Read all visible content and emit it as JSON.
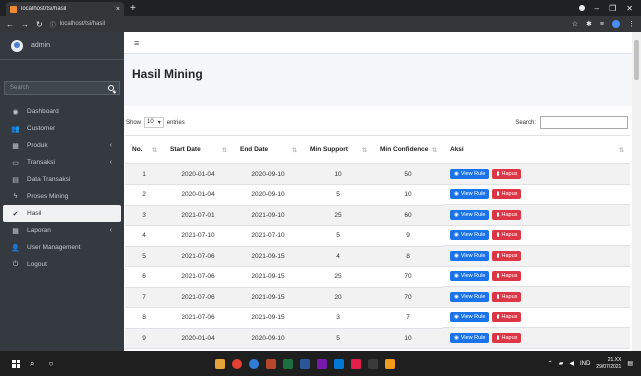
{
  "browser": {
    "tab_title": "localhost/tsi/hasil",
    "url": "localhost/tsi/hasil",
    "tab_close": "×",
    "new_tab": "+"
  },
  "sidebar": {
    "user": "admin",
    "search_placeholder": "Search",
    "items": [
      {
        "label": "Dashboard",
        "icon": "dashboard-icon",
        "glyph": "◉",
        "chevron": ""
      },
      {
        "label": "Customer",
        "icon": "users-icon",
        "glyph": "👥",
        "chevron": ""
      },
      {
        "label": "Produk",
        "icon": "table-icon",
        "glyph": "▦",
        "chevron": "‹"
      },
      {
        "label": "Transaksi",
        "icon": "tv-icon",
        "glyph": "▭",
        "chevron": "‹"
      },
      {
        "label": "Data Transaksi",
        "icon": "file-icon",
        "glyph": "▤",
        "chevron": ""
      },
      {
        "label": "Proses Mining",
        "icon": "bolt-icon",
        "glyph": "ϟ",
        "chevron": ""
      },
      {
        "label": "Hasil",
        "icon": "check-icon",
        "glyph": "✔",
        "chevron": ""
      },
      {
        "label": "Laporan",
        "icon": "report-icon",
        "glyph": "▦",
        "chevron": "‹"
      },
      {
        "label": "User Management",
        "icon": "user-icon",
        "glyph": "👤",
        "chevron": ""
      },
      {
        "label": "Logout",
        "icon": "power-icon",
        "glyph": "⏻",
        "chevron": ""
      }
    ]
  },
  "topbar": {
    "menu_glyph": "≡"
  },
  "page": {
    "title": "Hasil Mining"
  },
  "table_controls": {
    "show_label": "Show",
    "length_value": "10",
    "entries_label": "entries",
    "search_label": "Search:"
  },
  "table": {
    "columns": [
      "No.",
      "Start Date",
      "End Date",
      "Min Support",
      "Min Confidence",
      "Aksi"
    ],
    "rows": [
      [
        "1",
        "2020-01-04",
        "2020-09-10",
        "10",
        "50"
      ],
      [
        "2",
        "2020-01-04",
        "2020-09-10",
        "5",
        "10"
      ],
      [
        "3",
        "2021-07-01",
        "2021-09-10",
        "25",
        "60"
      ],
      [
        "4",
        "2021-07-10",
        "2021-07-10",
        "5",
        "9"
      ],
      [
        "5",
        "2021-07-06",
        "2021-09-15",
        "4",
        "8"
      ],
      [
        "6",
        "2021-07-06",
        "2021-09-15",
        "25",
        "70"
      ],
      [
        "7",
        "2021-07-06",
        "2021-09-15",
        "20",
        "70"
      ],
      [
        "8",
        "2021-07-06",
        "2021-09-15",
        "3",
        "7"
      ],
      [
        "9",
        "2020-01-04",
        "2020-09-10",
        "5",
        "10"
      ]
    ],
    "view_label": "View Rule",
    "delete_label": "Hapus"
  },
  "taskbar": {
    "tray_lang": "IND",
    "time": "21.XX",
    "date": "29/07/2021"
  },
  "colors": {
    "sidebar_bg": "#343a40",
    "view_btn": "#1a73e8",
    "delete_btn": "#dc3545"
  }
}
